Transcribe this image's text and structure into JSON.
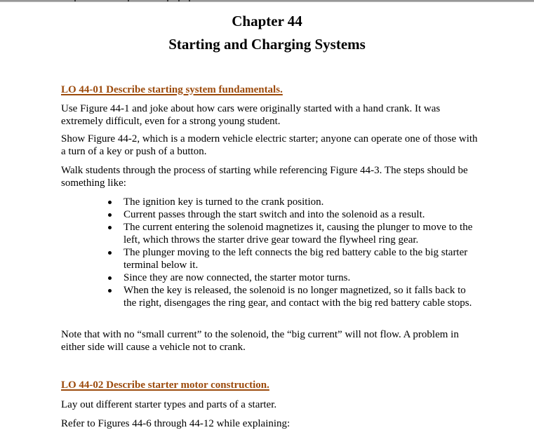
{
  "document": {
    "chapter_title": "Chapter 44",
    "chapter_subtitle": "Starting and Charging Systems",
    "heading_color": "#9c4a0b",
    "sections": [
      {
        "heading": "LO 44-01 Describe starting system fundamentals.",
        "paragraphs": [
          "Use Figure 44-1 and joke about how cars were originally started with a hand crank. It was extremely difficult, even for a strong young student.",
          "Show Figure 44-2, which is a modern vehicle electric starter; anyone can operate one of those with a turn of a key or push of a button.",
          "Walk students through the process of starting while referencing Figure 44-3. The steps should be something like:"
        ],
        "bullets": [
          "The ignition key is turned to the crank position.",
          "Current passes through the start switch and into the solenoid as a result.",
          "The current entering the solenoid magnetizes it, causing the plunger to move to the left, which throws the starter drive gear toward the flywheel ring gear.",
          "The plunger moving to the left connects the big red battery cable to the big starter terminal below it.",
          "Since they are now connected, the starter motor turns.",
          "When the key is released, the solenoid is no longer magnetized, so it falls back to the right, disengages the ring gear, and contact with the big red battery cable stops."
        ],
        "closing_paragraph": "Note that with no “small current” to the solenoid, the “big current” will not flow. A problem in either side will cause a vehicle not to crank."
      },
      {
        "heading": "LO 44-02 Describe starter motor construction.",
        "paragraphs": [
          "Lay out different starter types and parts of a starter.",
          "Refer to Figures 44-6 through 44-12 while explaining:"
        ]
      }
    ]
  }
}
